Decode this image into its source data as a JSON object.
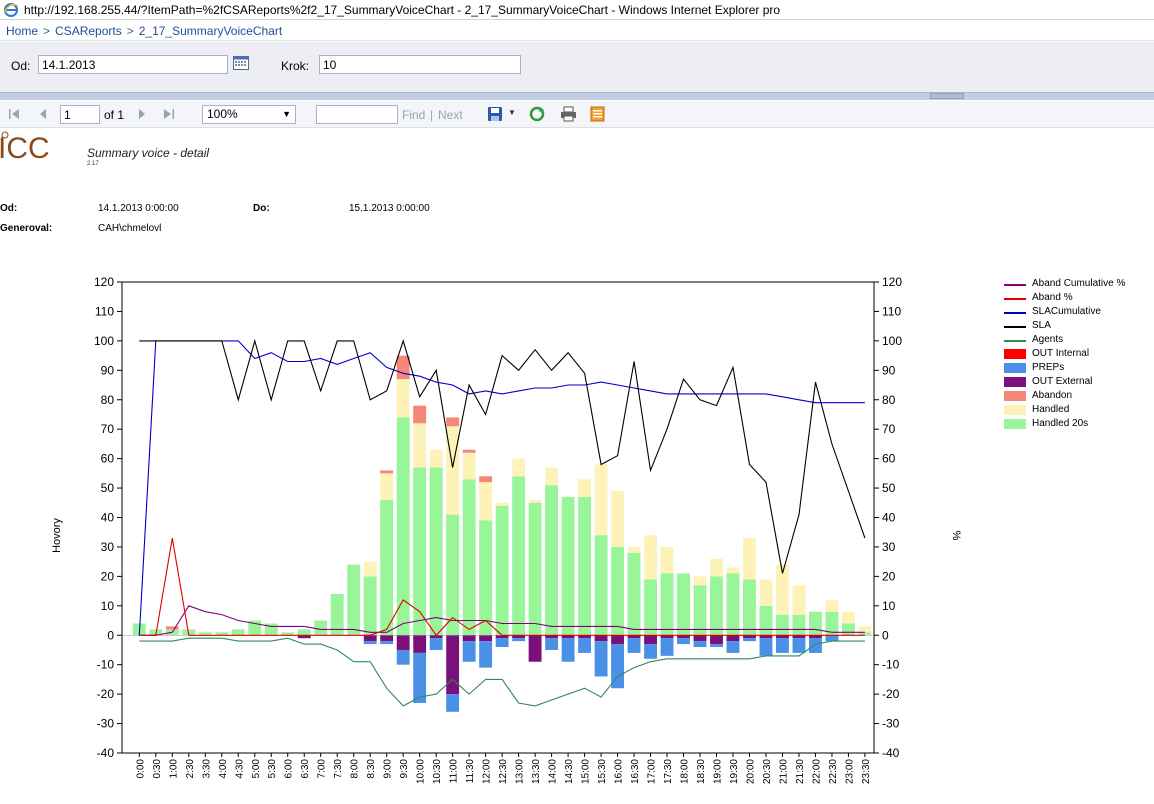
{
  "window": {
    "title": "http://192.168.255.44/?ItemPath=%2fCSAReports%2f2_17_SummaryVoiceChart - 2_17_SummaryVoiceChart - Windows Internet Explorer pro"
  },
  "breadcrumb": {
    "home": "Home",
    "sep": ">",
    "folder": "CSAReports",
    "report": "2_17_SummaryVoiceChart"
  },
  "params": {
    "od_label": "Od:",
    "od_value": "14.1.2013",
    "krok_label": "Krok:",
    "krok_value": "10"
  },
  "toolbar": {
    "page": "1",
    "of_label": "of 1",
    "zoom": "100%",
    "find_label": "Find",
    "divider": "|",
    "next_label": "Next",
    "find_value": ""
  },
  "report": {
    "logo_text": "ICC",
    "title": "Summary voice - detail",
    "version": "2.17",
    "od_label": "Od:",
    "od_value": "14.1.2013 0:00:00",
    "do_label": "Do:",
    "do_value": "15.1.2013 0:00:00",
    "generoval_label": "Generoval:",
    "generoval_value": "CAH\\chmelovl"
  },
  "colors": {
    "handled20s": "#98f598",
    "handled": "#fdf3b8",
    "abandon": "#f58778",
    "out_external": "#7b0f7b",
    "preps": "#4a90e6",
    "out_internal": "#ff0000",
    "agents": "#2e8b57",
    "sla": "#000000",
    "sla_cumulative": "#0000cc",
    "aband_pct": "#e00000",
    "aband_cumulative": "#800080"
  },
  "chart_data": {
    "type": "bar",
    "ylabel": "Hovory",
    "y2label": "%",
    "ylim": [
      -40,
      120
    ],
    "y2lim": [
      -40,
      120
    ],
    "yticks": [
      120,
      110,
      100,
      90,
      80,
      70,
      60,
      50,
      40,
      30,
      20,
      10,
      0,
      -10,
      -20,
      -30,
      -40
    ],
    "categories": [
      "0:00",
      "0:30",
      "1:00",
      "2:30",
      "3:30",
      "4:00",
      "4:30",
      "5:00",
      "5:30",
      "6:00",
      "6:30",
      "7:00",
      "7:30",
      "8:00",
      "8:30",
      "9:00",
      "9:30",
      "10:00",
      "10:30",
      "11:00",
      "11:30",
      "12:00",
      "12:30",
      "13:00",
      "13:30",
      "14:00",
      "14:30",
      "15:00",
      "15:30",
      "16:00",
      "16:30",
      "17:00",
      "17:30",
      "18:00",
      "18:30",
      "19:00",
      "19:30",
      "20:00",
      "20:30",
      "21:00",
      "21:30",
      "22:00",
      "22:30",
      "23:00",
      "23:30"
    ],
    "legend_position": "right",
    "legend": [
      {
        "label": "Aband Cumulative %",
        "kind": "line",
        "color": "#800080"
      },
      {
        "label": "Aband %",
        "kind": "line",
        "color": "#e00000"
      },
      {
        "label": "SLACumulative",
        "kind": "line",
        "color": "#0000cc"
      },
      {
        "label": "SLA",
        "kind": "line",
        "color": "#000000"
      },
      {
        "label": "Agents",
        "kind": "line",
        "color": "#2e8b57"
      },
      {
        "label": "OUT Internal",
        "kind": "box",
        "color": "#ff0000"
      },
      {
        "label": "PREPs",
        "kind": "box",
        "color": "#4a90e6"
      },
      {
        "label": "OUT External",
        "kind": "box",
        "color": "#7b0f7b"
      },
      {
        "label": "Abandon",
        "kind": "box",
        "color": "#f58778"
      },
      {
        "label": "Handled",
        "kind": "box",
        "color": "#fdf3b8"
      },
      {
        "label": "Handled 20s",
        "kind": "box",
        "color": "#98f598"
      }
    ],
    "stacked_positive": [
      {
        "name": "Handled 20s",
        "color": "#98f598",
        "values": [
          4,
          2,
          2,
          2,
          1,
          1,
          2,
          5,
          4,
          1,
          2,
          5,
          14,
          24,
          20,
          46,
          74,
          57,
          57,
          41,
          53,
          39,
          44,
          54,
          45,
          51,
          47,
          47,
          34,
          30,
          28,
          19,
          21,
          21,
          17,
          20,
          21,
          19,
          10,
          7,
          7,
          8,
          8,
          4,
          1
        ]
      },
      {
        "name": "Handled",
        "color": "#fdf3b8",
        "values": [
          0,
          0,
          0,
          0,
          0,
          0,
          0,
          0,
          0,
          0,
          0,
          0,
          0,
          0,
          5,
          9,
          13,
          15,
          6,
          30,
          9,
          13,
          1,
          6,
          1,
          6,
          0,
          6,
          24,
          19,
          2,
          15,
          9,
          0,
          3,
          6,
          2,
          14,
          9,
          17,
          10,
          0,
          4,
          4,
          2
        ]
      },
      {
        "name": "Abandon",
        "color": "#f58778",
        "values": [
          0,
          0,
          1,
          0,
          0,
          0,
          0,
          0,
          0,
          0,
          0,
          0,
          0,
          0,
          0,
          1,
          8,
          6,
          0,
          3,
          1,
          2,
          0,
          0,
          0,
          0,
          0,
          0,
          0,
          0,
          0,
          0,
          0,
          0,
          0,
          0,
          0,
          0,
          0,
          0,
          0,
          0,
          0,
          0,
          0
        ]
      }
    ],
    "stacked_negative": [
      {
        "name": "OUT External",
        "color": "#7b0f7b",
        "values": [
          0,
          0,
          0,
          0,
          0,
          0,
          0,
          0,
          0,
          0,
          -1,
          0,
          0,
          0,
          -2,
          -2,
          -5,
          -6,
          -1,
          -20,
          -2,
          -2,
          -1,
          -1,
          -9,
          -1,
          -1,
          -1,
          -2,
          -3,
          -1,
          -3,
          -1,
          -1,
          -2,
          -3,
          -2,
          -1,
          -1,
          -1,
          -1,
          -1,
          0,
          0,
          0
        ]
      },
      {
        "name": "PREPs",
        "color": "#4a90e6",
        "values": [
          0,
          0,
          0,
          0,
          0,
          0,
          0,
          0,
          0,
          0,
          0,
          0,
          0,
          0,
          -1,
          -1,
          -5,
          -17,
          -4,
          -6,
          -7,
          -9,
          -3,
          -1,
          0,
          -4,
          -8,
          -5,
          -12,
          -15,
          -5,
          -5,
          -6,
          -2,
          -2,
          -1,
          -4,
          -1,
          -6,
          -5,
          -5,
          -5,
          -2,
          0,
          0
        ]
      }
    ],
    "lines": [
      {
        "name": "SLA",
        "color": "#000000",
        "axis": "right",
        "values": [
          100,
          100,
          100,
          100,
          100,
          100,
          80,
          100,
          80,
          100,
          100,
          83,
          100,
          100,
          80,
          83,
          100,
          81,
          90,
          57,
          85,
          75,
          95,
          90,
          97,
          90,
          96,
          89,
          58,
          61,
          93,
          56,
          70,
          87,
          80,
          78,
          91,
          58,
          52,
          21,
          41,
          86,
          65,
          49,
          33
        ]
      },
      {
        "name": "SLACumulative",
        "color": "#0000cc",
        "axis": "right",
        "values": [
          0,
          100,
          100,
          100,
          100,
          100,
          100,
          94,
          96,
          93,
          93,
          94,
          92,
          94,
          96,
          91,
          89,
          88,
          86,
          85,
          82,
          83,
          82,
          83,
          84,
          84,
          85,
          85,
          86,
          85,
          84,
          83,
          82,
          82,
          82,
          82,
          82,
          82,
          82,
          81,
          80,
          79,
          79,
          79,
          79
        ]
      },
      {
        "name": "Aband %",
        "color": "#e00000",
        "axis": "right",
        "values": [
          0,
          0,
          33,
          0,
          0,
          0,
          0,
          0,
          0,
          0,
          0,
          0,
          0,
          0,
          0,
          2,
          12,
          8,
          0,
          6,
          2,
          5,
          0,
          0,
          0,
          0,
          0,
          0,
          0,
          0,
          0,
          0,
          0,
          0,
          0,
          0,
          0,
          0,
          0,
          0,
          0,
          0,
          0,
          0,
          0
        ]
      },
      {
        "name": "Aband Cumulative %",
        "color": "#800080",
        "axis": "right",
        "values": [
          0,
          0,
          1,
          10,
          8,
          7,
          5,
          4,
          3,
          3,
          3,
          2,
          2,
          2,
          1,
          1,
          4,
          5,
          6,
          5,
          5,
          5,
          4,
          4,
          4,
          3,
          3,
          3,
          3,
          3,
          2,
          2,
          2,
          2,
          2,
          2,
          2,
          2,
          2,
          2,
          2,
          2,
          1,
          1,
          1
        ]
      },
      {
        "name": "Agents",
        "color": "#2e8b57",
        "axis": "left",
        "values": [
          -2,
          -2,
          -2,
          -1,
          -1,
          -1,
          -2,
          -2,
          -2,
          -1,
          -3,
          -3,
          -5,
          -9,
          -9,
          -18,
          -24,
          -21,
          -20,
          -15,
          -20,
          -15,
          -15,
          -23,
          -24,
          -22,
          -20,
          -18,
          -21,
          -14,
          -11,
          -9,
          -8,
          -8,
          -8,
          -8,
          -8,
          -8,
          -7,
          -7,
          -7,
          -3,
          -2,
          -2,
          -2
        ]
      }
    ]
  }
}
